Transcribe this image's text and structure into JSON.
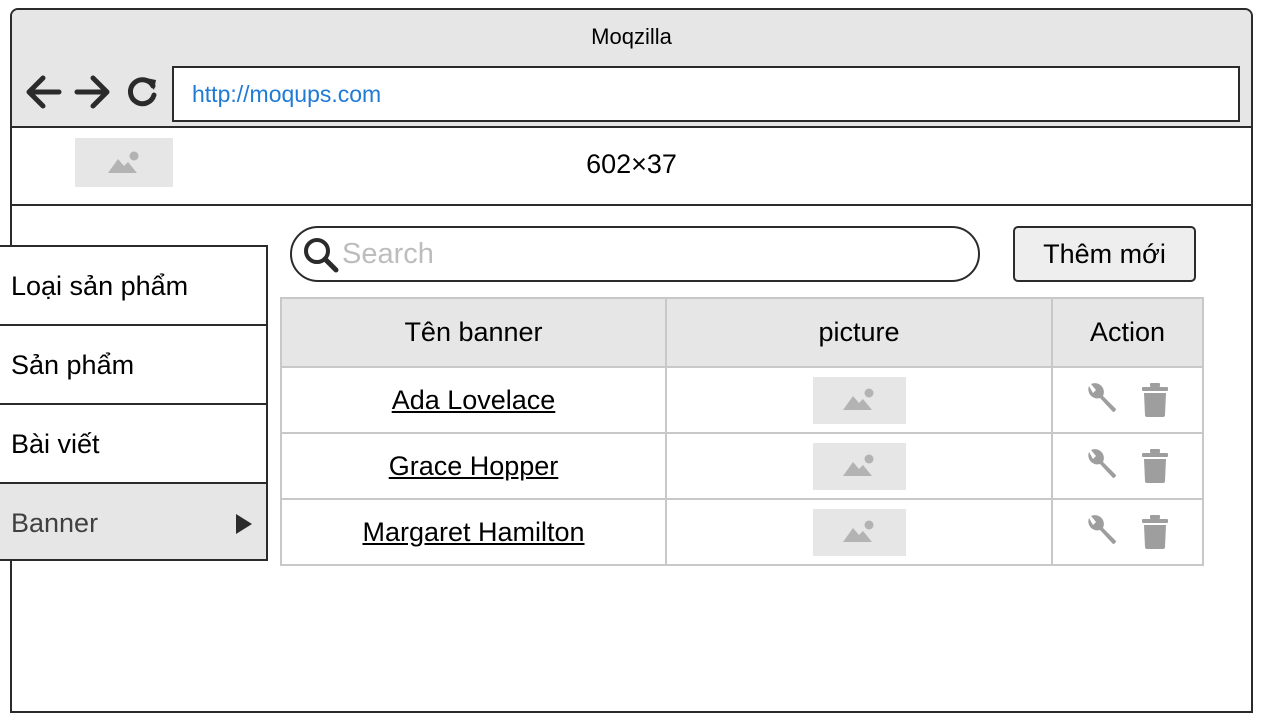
{
  "window": {
    "title": "Moqzilla"
  },
  "browser": {
    "url": "http://moqups.com"
  },
  "header": {
    "caption": "602×37"
  },
  "sidebar": {
    "items": [
      {
        "label": "Loại sản phẩm"
      },
      {
        "label": "Sản phẩm"
      },
      {
        "label": "Bài viết"
      },
      {
        "label": "Banner"
      }
    ]
  },
  "search": {
    "placeholder": "Search",
    "value": ""
  },
  "toolbar": {
    "add_label": "Thêm mới"
  },
  "table": {
    "headers": [
      "Tên banner",
      "picture",
      "Action"
    ],
    "rows": [
      {
        "name": "Ada Lovelace"
      },
      {
        "name": "Grace Hopper"
      },
      {
        "name": "Margaret Hamilton"
      }
    ]
  },
  "colors": {
    "link": "#1f7ad6",
    "chrome": "#e6e6e6",
    "border": "#2b2b2b",
    "icon": "#9e9e9e"
  },
  "icons": [
    "back-arrow-icon",
    "forward-arrow-icon",
    "reload-icon",
    "image-placeholder-icon",
    "search-icon",
    "wrench-icon",
    "trash-icon",
    "chevron-right-icon"
  ]
}
